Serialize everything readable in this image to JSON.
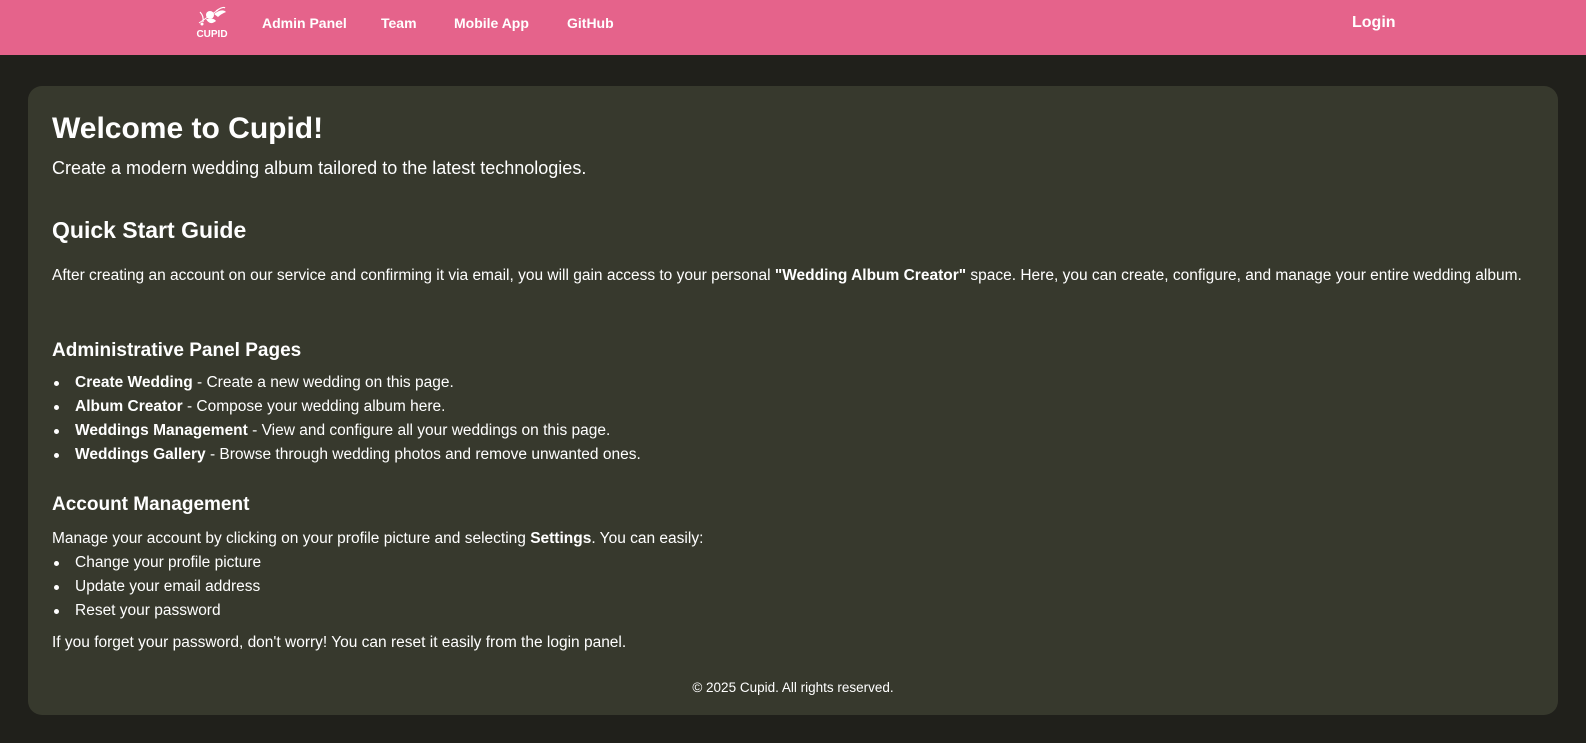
{
  "colors": {
    "navbar": "#e5638b",
    "background": "#20201b",
    "card": "#37392d",
    "text": "#ffffff"
  },
  "navbar": {
    "logo_icon": "cupid-cherub-icon",
    "logo_text": "CUPID",
    "links": {
      "admin_panel": "Admin Panel",
      "team": "Team",
      "mobile_app": "Mobile App",
      "github": "GitHub"
    },
    "login": "Login"
  },
  "main": {
    "title": "Welcome to Cupid!",
    "subtitle": "Create a modern wedding album tailored to the latest technologies.",
    "quick_start": {
      "heading": "Quick Start Guide",
      "text_before": "After creating an account on our service and confirming it via email, you will gain access to your personal ",
      "text_bold": "\"Wedding Album Creator\"",
      "text_after": " space. Here, you can create, configure, and manage your entire wedding album."
    },
    "admin_pages": {
      "heading": "Administrative Panel Pages",
      "items": [
        {
          "name": "Create Wedding",
          "desc": " - Create a new wedding on this page."
        },
        {
          "name": "Album Creator",
          "desc": " - Compose your wedding album here."
        },
        {
          "name": "Weddings Management",
          "desc": " - View and configure all your weddings on this page."
        },
        {
          "name": "Weddings Gallery",
          "desc": " - Browse through wedding photos and remove unwanted ones."
        }
      ]
    },
    "account": {
      "heading": "Account Management",
      "text_before": "Manage your account by clicking on your profile picture and selecting ",
      "text_bold": "Settings",
      "text_after": ". You can easily:",
      "items": [
        "Change your profile picture",
        "Update your email address",
        "Reset your password"
      ],
      "forget_text": "If you forget your password, don't worry! You can reset it easily from the login panel."
    },
    "footer": "© 2025 Cupid. All rights reserved."
  }
}
